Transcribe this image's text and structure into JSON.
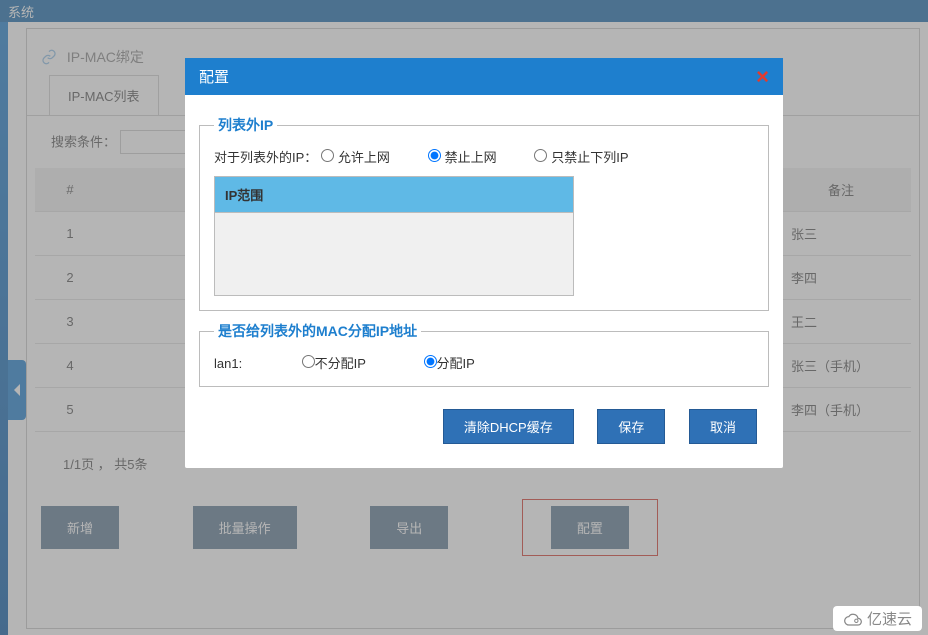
{
  "topbar": {
    "title": "系统"
  },
  "crumb": {
    "label": "IP-MAC绑定"
  },
  "tabs": [
    {
      "label": "IP-MAC列表"
    }
  ],
  "search": {
    "label": "搜索条件："
  },
  "table": {
    "headers": {
      "idx": "#",
      "remark": "备注"
    },
    "rows": [
      {
        "idx": "1",
        "remark": "张三"
      },
      {
        "idx": "2",
        "remark": "李四"
      },
      {
        "idx": "3",
        "remark": "王二"
      },
      {
        "idx": "4",
        "remark": "张三（手机）"
      },
      {
        "idx": "5",
        "remark": "李四（手机）"
      }
    ]
  },
  "pager": {
    "text": "1/1页 ， 共5条"
  },
  "buttons": {
    "add": "新增",
    "batch": "批量操作",
    "export": "导出",
    "config": "配置"
  },
  "dialog": {
    "title": "配置",
    "fs1": {
      "legend": "列表外IP",
      "prompt": "对于列表外的IP：",
      "opt_allow": "允许上网",
      "opt_deny": "禁止上网",
      "opt_onlydeny": "只禁止下列IP",
      "selected": "deny",
      "range_header": "IP范围"
    },
    "fs2": {
      "legend": "是否给列表外的MAC分配IP地址",
      "lan_label": "lan1:",
      "opt_no": "不分配IP",
      "opt_yes": "分配IP",
      "selected": "yes"
    },
    "btns": {
      "clear": "清除DHCP缓存",
      "save": "保存",
      "cancel": "取消"
    }
  },
  "watermark": {
    "text": "亿速云"
  }
}
